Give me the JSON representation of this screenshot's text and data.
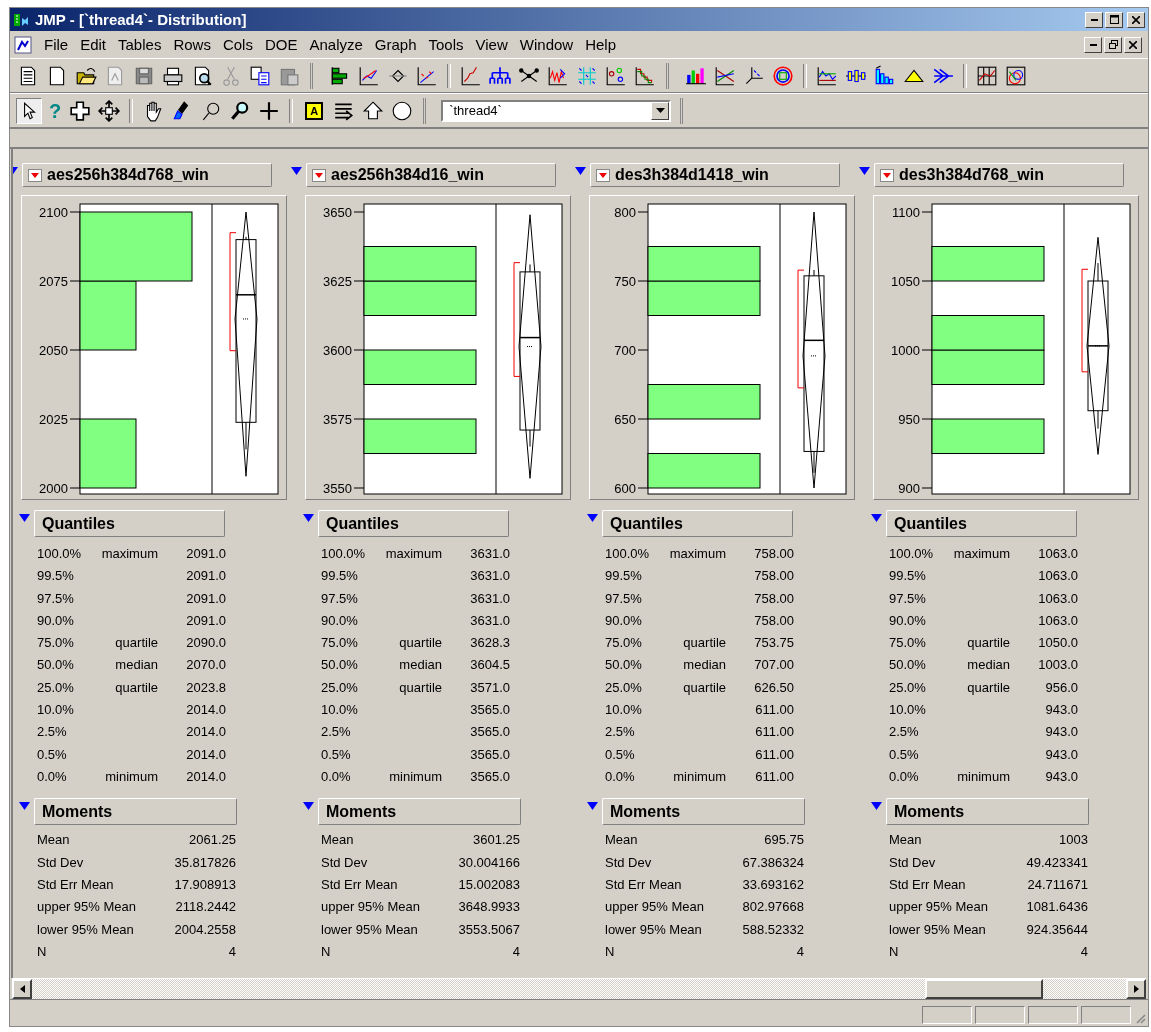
{
  "window": {
    "title": "JMP - [`thread4`- Distribution]"
  },
  "menu": [
    {
      "label": "File"
    },
    {
      "label": "Edit"
    },
    {
      "label": "Tables"
    },
    {
      "label": "Rows"
    },
    {
      "label": "Cols"
    },
    {
      "label": "DOE"
    },
    {
      "label": "Analyze"
    },
    {
      "label": "Graph"
    },
    {
      "label": "Tools"
    },
    {
      "label": "View"
    },
    {
      "label": "Window"
    },
    {
      "label": "Help"
    }
  ],
  "toolbar": {
    "help_button": "?",
    "annotate_button": "A",
    "table_combo": {
      "value": "`thread4`"
    }
  },
  "panels": [
    {
      "title": "aes256h384d768_win",
      "axis_ticks": [
        "2100",
        "2075",
        "2050",
        "2025",
        "2000"
      ],
      "quantiles": {
        "title": "Quantiles",
        "rows": [
          {
            "percent": "100.0%",
            "label": "maximum",
            "value": "2091.0"
          },
          {
            "percent": "99.5%",
            "value": "2091.0"
          },
          {
            "percent": "97.5%",
            "value": "2091.0"
          },
          {
            "percent": "90.0%",
            "value": "2091.0"
          },
          {
            "percent": "75.0%",
            "label": "quartile",
            "value": "2090.0"
          },
          {
            "percent": "50.0%",
            "label": "median",
            "value": "2070.0"
          },
          {
            "percent": "25.0%",
            "label": "quartile",
            "value": "2023.8"
          },
          {
            "percent": "10.0%",
            "value": "2014.0"
          },
          {
            "percent": "2.5%",
            "value": "2014.0"
          },
          {
            "percent": "0.5%",
            "value": "2014.0"
          },
          {
            "percent": "0.0%",
            "label": "minimum",
            "value": "2014.0"
          }
        ]
      },
      "moments": {
        "title": "Moments",
        "rows": [
          {
            "label": "Mean",
            "value": "2061.25"
          },
          {
            "label": "Std Dev",
            "value": "35.817826"
          },
          {
            "label": "Std Err Mean",
            "value": "17.908913"
          },
          {
            "label": "upper 95% Mean",
            "value": "2118.2442"
          },
          {
            "label": "lower 95% Mean",
            "value": "2004.2558"
          },
          {
            "label": "N",
            "value": "4"
          }
        ]
      }
    },
    {
      "title": "aes256h384d16_win",
      "axis_ticks": [
        "3650",
        "3625",
        "3600",
        "3575",
        "3550"
      ],
      "quantiles": {
        "title": "Quantiles",
        "rows": [
          {
            "percent": "100.0%",
            "label": "maximum",
            "value": "3631.0"
          },
          {
            "percent": "99.5%",
            "value": "3631.0"
          },
          {
            "percent": "97.5%",
            "value": "3631.0"
          },
          {
            "percent": "90.0%",
            "value": "3631.0"
          },
          {
            "percent": "75.0%",
            "label": "quartile",
            "value": "3628.3"
          },
          {
            "percent": "50.0%",
            "label": "median",
            "value": "3604.5"
          },
          {
            "percent": "25.0%",
            "label": "quartile",
            "value": "3571.0"
          },
          {
            "percent": "10.0%",
            "value": "3565.0"
          },
          {
            "percent": "2.5%",
            "value": "3565.0"
          },
          {
            "percent": "0.5%",
            "value": "3565.0"
          },
          {
            "percent": "0.0%",
            "label": "minimum",
            "value": "3565.0"
          }
        ]
      },
      "moments": {
        "title": "Moments",
        "rows": [
          {
            "label": "Mean",
            "value": "3601.25"
          },
          {
            "label": "Std Dev",
            "value": "30.004166"
          },
          {
            "label": "Std Err Mean",
            "value": "15.002083"
          },
          {
            "label": "upper 95% Mean",
            "value": "3648.9933"
          },
          {
            "label": "lower 95% Mean",
            "value": "3553.5067"
          },
          {
            "label": "N",
            "value": "4"
          }
        ]
      }
    },
    {
      "title": "des3h384d1418_win",
      "axis_ticks": [
        "800",
        "750",
        "700",
        "650",
        "600"
      ],
      "quantiles": {
        "title": "Quantiles",
        "rows": [
          {
            "percent": "100.0%",
            "label": "maximum",
            "value": "758.00"
          },
          {
            "percent": "99.5%",
            "value": "758.00"
          },
          {
            "percent": "97.5%",
            "value": "758.00"
          },
          {
            "percent": "90.0%",
            "value": "758.00"
          },
          {
            "percent": "75.0%",
            "label": "quartile",
            "value": "753.75"
          },
          {
            "percent": "50.0%",
            "label": "median",
            "value": "707.00"
          },
          {
            "percent": "25.0%",
            "label": "quartile",
            "value": "626.50"
          },
          {
            "percent": "10.0%",
            "value": "611.00"
          },
          {
            "percent": "2.5%",
            "value": "611.00"
          },
          {
            "percent": "0.5%",
            "value": "611.00"
          },
          {
            "percent": "0.0%",
            "label": "minimum",
            "value": "611.00"
          }
        ]
      },
      "moments": {
        "title": "Moments",
        "rows": [
          {
            "label": "Mean",
            "value": "695.75"
          },
          {
            "label": "Std Dev",
            "value": "67.386324"
          },
          {
            "label": "Std Err Mean",
            "value": "33.693162"
          },
          {
            "label": "upper 95% Mean",
            "value": "802.97668"
          },
          {
            "label": "lower 95% Mean",
            "value": "588.52332"
          },
          {
            "label": "N",
            "value": "4"
          }
        ]
      }
    },
    {
      "title": "des3h384d768_win",
      "axis_ticks": [
        "1100",
        "1050",
        "1000",
        "950",
        "900"
      ],
      "quantiles": {
        "title": "Quantiles",
        "rows": [
          {
            "percent": "100.0%",
            "label": "maximum",
            "value": "1063.0"
          },
          {
            "percent": "99.5%",
            "value": "1063.0"
          },
          {
            "percent": "97.5%",
            "value": "1063.0"
          },
          {
            "percent": "90.0%",
            "value": "1063.0"
          },
          {
            "percent": "75.0%",
            "label": "quartile",
            "value": "1050.0"
          },
          {
            "percent": "50.0%",
            "label": "median",
            "value": "1003.0"
          },
          {
            "percent": "25.0%",
            "label": "quartile",
            "value": "956.0"
          },
          {
            "percent": "10.0%",
            "value": "943.0"
          },
          {
            "percent": "2.5%",
            "value": "943.0"
          },
          {
            "percent": "0.5%",
            "value": "943.0"
          },
          {
            "percent": "0.0%",
            "label": "minimum",
            "value": "943.0"
          }
        ]
      },
      "moments": {
        "title": "Moments",
        "rows": [
          {
            "label": "Mean",
            "value": "1003"
          },
          {
            "label": "Std Dev",
            "value": "49.423341"
          },
          {
            "label": "Std Err Mean",
            "value": "24.711671"
          },
          {
            "label": "upper 95% Mean",
            "value": "1081.6436"
          },
          {
            "label": "lower 95% Mean",
            "value": "924.35644"
          },
          {
            "label": "N",
            "value": "4"
          }
        ]
      }
    }
  ]
}
